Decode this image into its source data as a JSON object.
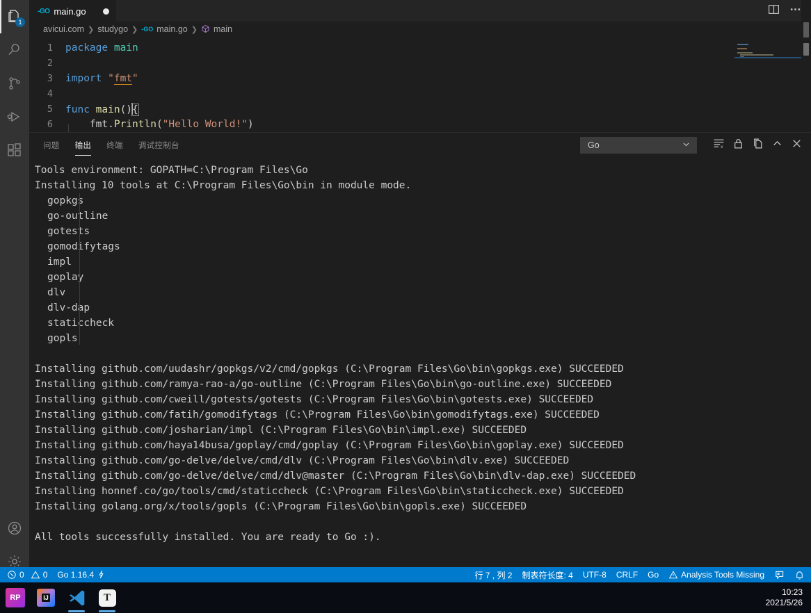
{
  "activity_bar": {
    "items": [
      {
        "name": "explorer",
        "icon": "files-icon",
        "badge": "1",
        "active": true
      },
      {
        "name": "search",
        "icon": "search-icon",
        "badge": "",
        "active": false
      },
      {
        "name": "source-control",
        "icon": "source-control-icon",
        "badge": "",
        "active": false
      },
      {
        "name": "run-debug",
        "icon": "run-debug-icon",
        "badge": "",
        "active": false
      },
      {
        "name": "extensions",
        "icon": "extensions-icon",
        "badge": "",
        "active": false
      }
    ],
    "bottom": [
      {
        "name": "accounts",
        "icon": "account-icon"
      },
      {
        "name": "manage",
        "icon": "gear-icon"
      }
    ]
  },
  "editor": {
    "tab": {
      "label": "main.go",
      "icon": "go-file-icon",
      "dirty": true
    },
    "actions": [
      {
        "name": "split-editor-right",
        "icon": "split-editor-icon"
      },
      {
        "name": "more-actions",
        "icon": "ellipsis-icon"
      }
    ],
    "breadcrumb": [
      "avicui.com",
      "studygo",
      "main.go",
      "main"
    ],
    "lines": [
      {
        "num": "1",
        "tokens": [
          {
            "t": "package ",
            "c": "kw"
          },
          {
            "t": "main",
            "c": "pkg"
          }
        ]
      },
      {
        "num": "2",
        "tokens": []
      },
      {
        "num": "3",
        "tokens": [
          {
            "t": "import ",
            "c": "kw"
          },
          {
            "t": "\"",
            "c": "str"
          },
          {
            "t": "fmt",
            "c": "imp"
          },
          {
            "t": "\"",
            "c": "str"
          }
        ]
      },
      {
        "num": "4",
        "tokens": []
      },
      {
        "num": "5",
        "tokens": [
          {
            "t": "func ",
            "c": "kw"
          },
          {
            "t": "main",
            "c": "fn"
          },
          {
            "t": "()",
            "c": "punct"
          },
          {
            "t": "{",
            "c": "brace"
          }
        ]
      },
      {
        "num": "6",
        "tokens": [
          {
            "t": "    fmt.",
            "c": "punct"
          },
          {
            "t": "Println",
            "c": "fn"
          },
          {
            "t": "(",
            "c": "punct"
          },
          {
            "t": "\"Hello World!\"",
            "c": "str"
          },
          {
            "t": ")",
            "c": "punct"
          }
        ]
      }
    ]
  },
  "panel": {
    "tabs": [
      {
        "label": "问题",
        "name": "tab-problems",
        "active": false
      },
      {
        "label": "输出",
        "name": "tab-output",
        "active": true
      },
      {
        "label": "终端",
        "name": "tab-terminal",
        "active": false
      },
      {
        "label": "调试控制台",
        "name": "tab-debug-console",
        "active": false
      }
    ],
    "channel_select": {
      "value": "Go",
      "icon": "chevron-down-icon"
    },
    "actions": [
      {
        "name": "clear-output-button",
        "icon": "clear-output-icon"
      },
      {
        "name": "lock-scroll-button",
        "icon": "lock-icon"
      },
      {
        "name": "open-in-editor-button",
        "icon": "open-editor-icon"
      },
      {
        "name": "maximize-panel-button",
        "icon": "chevron-up-icon"
      },
      {
        "name": "close-panel-button",
        "icon": "close-icon"
      }
    ],
    "output_lines": [
      {
        "text": "Tools environment: GOPATH=C:\\Program Files\\Go",
        "indent": false
      },
      {
        "text": "Installing 10 tools at C:\\Program Files\\Go\\bin in module mode.",
        "indent": false
      },
      {
        "text": "gopkgs",
        "indent": true
      },
      {
        "text": "go-outline",
        "indent": true
      },
      {
        "text": "gotests",
        "indent": true
      },
      {
        "text": "gomodifytags",
        "indent": true
      },
      {
        "text": "impl",
        "indent": true
      },
      {
        "text": "goplay",
        "indent": true
      },
      {
        "text": "dlv",
        "indent": true
      },
      {
        "text": "dlv-dap",
        "indent": true
      },
      {
        "text": "staticcheck",
        "indent": true
      },
      {
        "text": "gopls",
        "indent": true
      },
      {
        "text": "",
        "indent": false
      },
      {
        "text": "Installing github.com/uudashr/gopkgs/v2/cmd/gopkgs (C:\\Program Files\\Go\\bin\\gopkgs.exe) SUCCEEDED",
        "indent": false
      },
      {
        "text": "Installing github.com/ramya-rao-a/go-outline (C:\\Program Files\\Go\\bin\\go-outline.exe) SUCCEEDED",
        "indent": false
      },
      {
        "text": "Installing github.com/cweill/gotests/gotests (C:\\Program Files\\Go\\bin\\gotests.exe) SUCCEEDED",
        "indent": false
      },
      {
        "text": "Installing github.com/fatih/gomodifytags (C:\\Program Files\\Go\\bin\\gomodifytags.exe) SUCCEEDED",
        "indent": false
      },
      {
        "text": "Installing github.com/josharian/impl (C:\\Program Files\\Go\\bin\\impl.exe) SUCCEEDED",
        "indent": false
      },
      {
        "text": "Installing github.com/haya14busa/goplay/cmd/goplay (C:\\Program Files\\Go\\bin\\goplay.exe) SUCCEEDED",
        "indent": false
      },
      {
        "text": "Installing github.com/go-delve/delve/cmd/dlv (C:\\Program Files\\Go\\bin\\dlv.exe) SUCCEEDED",
        "indent": false
      },
      {
        "text": "Installing github.com/go-delve/delve/cmd/dlv@master (C:\\Program Files\\Go\\bin\\dlv-dap.exe) SUCCEEDED",
        "indent": false
      },
      {
        "text": "Installing honnef.co/go/tools/cmd/staticcheck (C:\\Program Files\\Go\\bin\\staticcheck.exe) SUCCEEDED",
        "indent": false
      },
      {
        "text": "Installing golang.org/x/tools/gopls (C:\\Program Files\\Go\\bin\\gopls.exe) SUCCEEDED",
        "indent": false
      },
      {
        "text": "",
        "indent": false
      },
      {
        "text": "All tools successfully installed. You are ready to Go :).",
        "indent": false
      }
    ]
  },
  "status_bar": {
    "left": [
      {
        "name": "problems-status",
        "icon": "error-icon",
        "text": "0",
        "icon2": "warning-icon",
        "text2": "0"
      },
      {
        "name": "go-version-status",
        "text": "Go 1.16.4",
        "icon": "lightning-icon"
      }
    ],
    "error_count": "0",
    "warning_count": "0",
    "go_version": "Go 1.16.4",
    "right": [
      {
        "name": "cursor-position-status",
        "text": "行 7 , 列 2"
      },
      {
        "name": "indent-status",
        "text": "制表符长度: 4"
      },
      {
        "name": "encoding-status",
        "text": "UTF-8"
      },
      {
        "name": "eol-status",
        "text": "CRLF"
      },
      {
        "name": "language-mode-status",
        "text": "Go"
      },
      {
        "name": "analysis-tools-status",
        "text": "Analysis Tools Missing",
        "icon": "warning-icon"
      },
      {
        "name": "feedback-status",
        "icon": "feedback-icon",
        "text": ""
      },
      {
        "name": "notifications-status",
        "icon": "bell-icon",
        "text": ""
      }
    ],
    "background": "#007acc"
  },
  "taskbar": {
    "items": [
      {
        "name": "taskbar-rp-app",
        "label": "RP",
        "running": false
      },
      {
        "name": "taskbar-intellij-idea",
        "label": "IJ",
        "running": false
      },
      {
        "name": "taskbar-vscode",
        "label": "VS",
        "running": true
      },
      {
        "name": "taskbar-typora",
        "label": "T",
        "running": true
      }
    ],
    "clock": {
      "time": "10:23",
      "date": "2021/5/26"
    }
  },
  "theme": {
    "editor_bg": "#1e1e1e",
    "activity_bg": "#333333",
    "tabbar_bg": "#252526",
    "status_bg": "#007acc",
    "accent": "#007acc"
  }
}
